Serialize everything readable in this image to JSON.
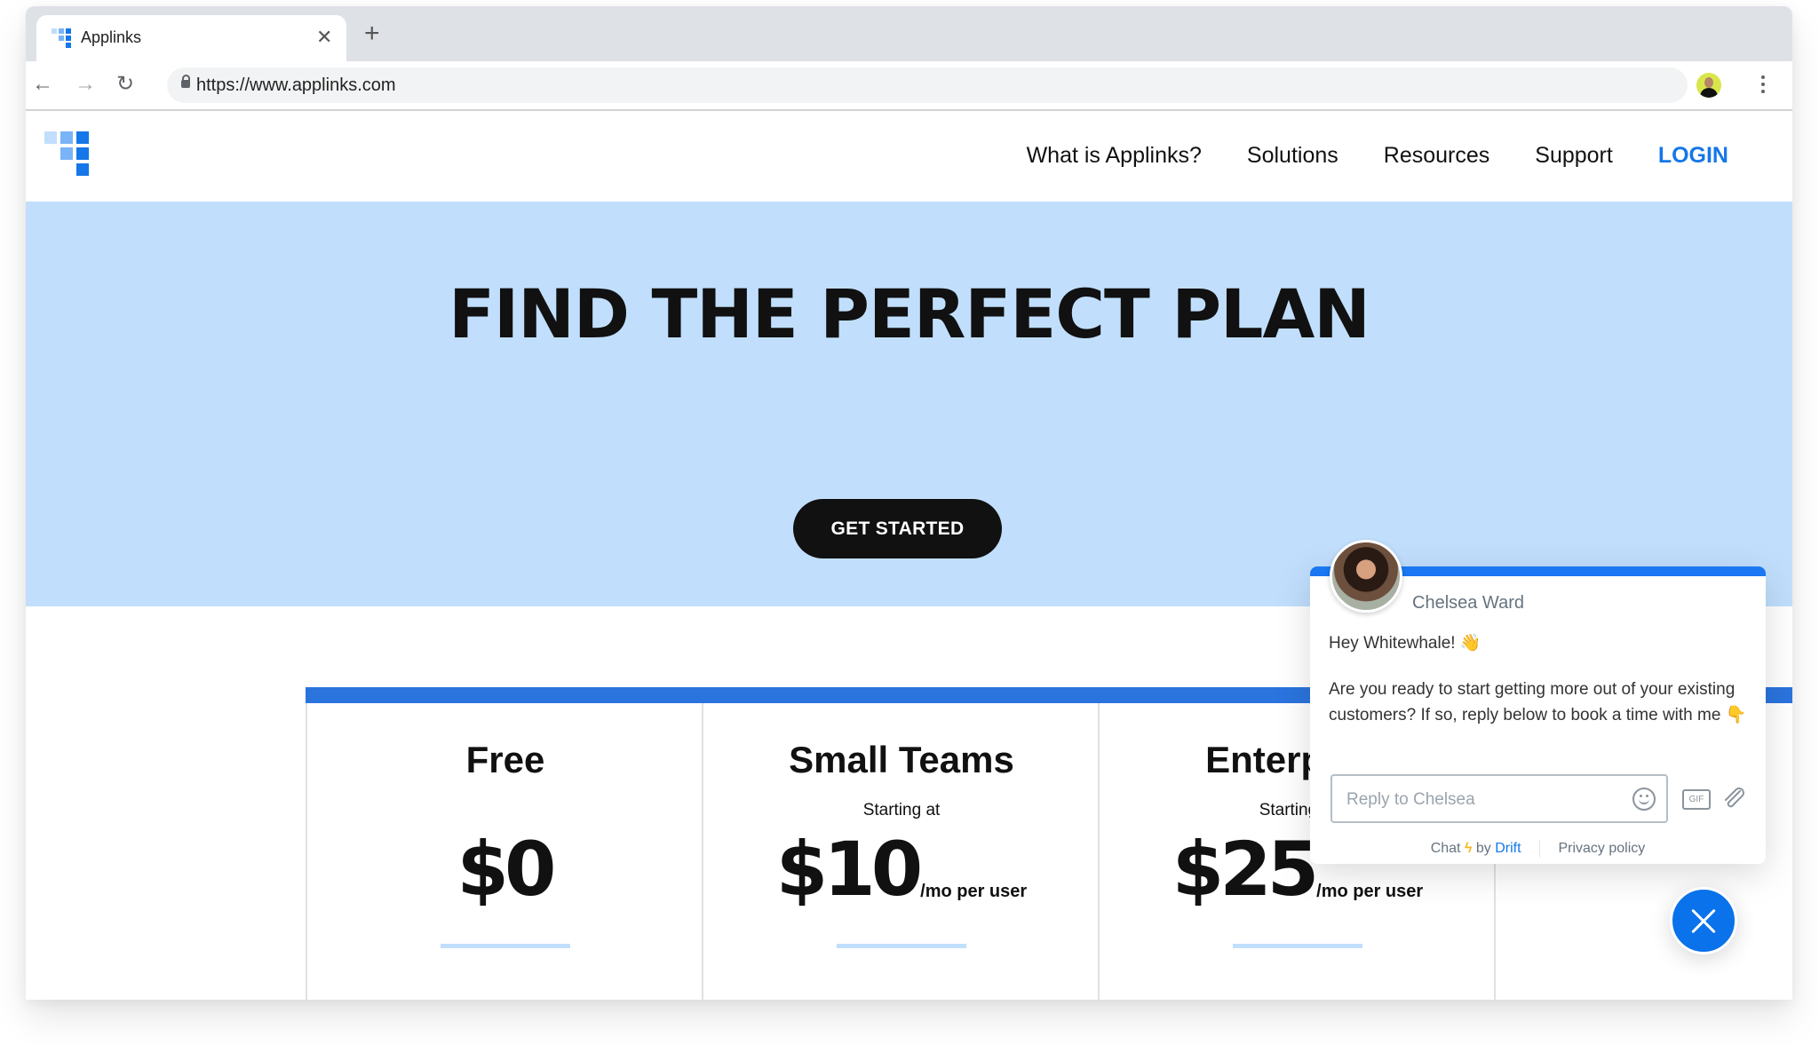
{
  "browser": {
    "tab_title": "Applinks",
    "url": "https://www.applinks.com",
    "icons": [
      "favicon-icon",
      "close-tab-icon",
      "new-tab-icon",
      "back-icon",
      "forward-icon",
      "reload-icon",
      "lock-icon",
      "profile-avatar",
      "menu-icon"
    ],
    "glyphs": {
      "close_tab": "✕",
      "new_tab": "+",
      "back": "←",
      "forward": "→",
      "reload": "↻"
    }
  },
  "site": {
    "nav": [
      {
        "label": "What is Applinks?"
      },
      {
        "label": "Solutions"
      },
      {
        "label": "Resources"
      },
      {
        "label": "Support"
      },
      {
        "label": "LOGIN"
      }
    ],
    "hero": {
      "title": "FIND THE PERFECT PLAN",
      "cta": "GET STARTED"
    },
    "plans": [
      {
        "name": "Free",
        "starting": "",
        "amount": "$0",
        "unit": ""
      },
      {
        "name": "Small Teams",
        "starting": "Starting at",
        "amount": "$10",
        "unit": "/mo per user"
      },
      {
        "name": "Enterprise",
        "starting": "Starting at",
        "amount": "$25",
        "unit": "/mo per user"
      }
    ],
    "colors": {
      "brand_blue": "#1577e8",
      "hero_bg": "#c1dffd",
      "pricing_bar": "#2b74de"
    }
  },
  "chat": {
    "agent_name": "Chelsea Ward",
    "greeting": "Hey Whitewhale! 👋",
    "message": "Are you ready to start getting more out of your existing customers? If so, reply below to book a time with me 👇",
    "input_placeholder": "Reply to Chelsea",
    "gif_label": "GIF",
    "footer_chat": "Chat",
    "footer_bolt": "ϟ",
    "footer_by": "by",
    "footer_brand": "Drift",
    "footer_privacy": "Privacy policy"
  }
}
